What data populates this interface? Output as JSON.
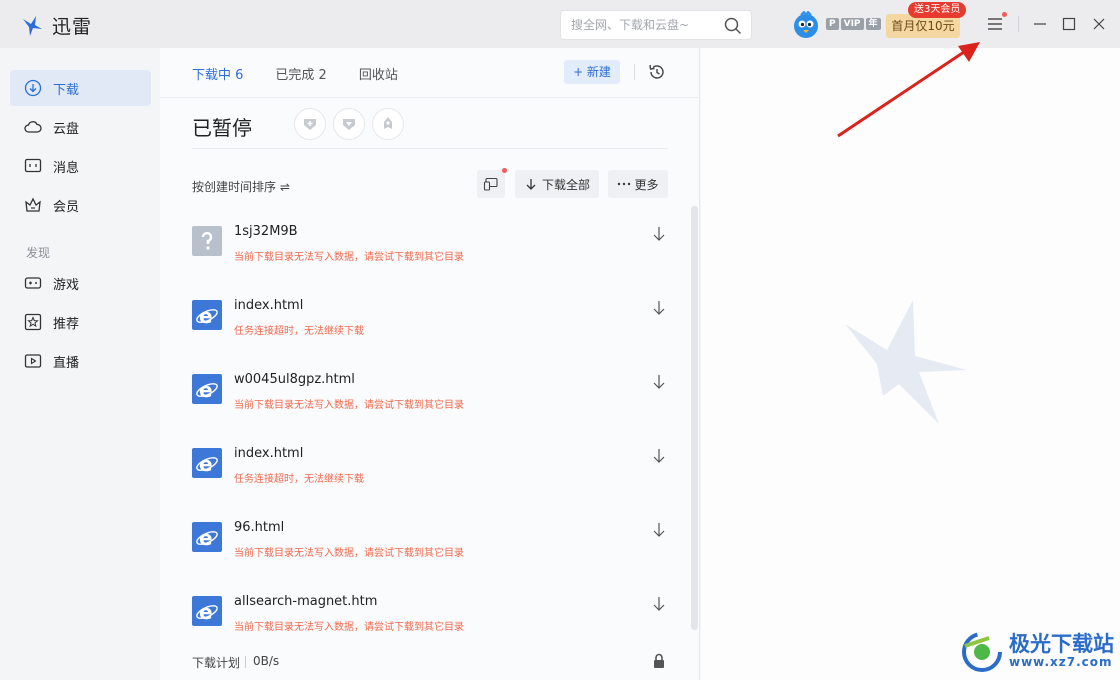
{
  "app": {
    "title": "迅雷"
  },
  "search": {
    "placeholder": "搜全网、下载和云盘~"
  },
  "account": {
    "badge_p": "P",
    "badge_vip": "VIP",
    "badge_year": "年"
  },
  "promo": {
    "label": "首月仅10元",
    "tag": "送3天会员"
  },
  "sidebar": {
    "items": [
      {
        "label": "下载",
        "icon": "download-icon",
        "active": true
      },
      {
        "label": "云盘",
        "icon": "cloud-icon"
      },
      {
        "label": "消息",
        "icon": "message-icon"
      },
      {
        "label": "会员",
        "icon": "crown-icon"
      }
    ],
    "section_label": "发现",
    "discover": [
      {
        "label": "游戏",
        "icon": "gamepad-icon"
      },
      {
        "label": "推荐",
        "icon": "star-icon"
      },
      {
        "label": "直播",
        "icon": "live-icon"
      }
    ]
  },
  "tabs": [
    {
      "label": "下载中 6",
      "active": true
    },
    {
      "label": "已完成 2"
    },
    {
      "label": "回收站"
    }
  ],
  "toolbar": {
    "new_label": "+ 新建"
  },
  "section": {
    "title": "已暂停"
  },
  "list_controls": {
    "sort_label": "按创建时间排序 ⇌",
    "download_all": "下载全部",
    "more": "更多"
  },
  "downloads": [
    {
      "name": "1sj32M9B",
      "error": "当前下载目录无法写入数据，请尝试下载到其它目录",
      "type": "unknown"
    },
    {
      "name": "index.html",
      "error": "任务连接超时，无法继续下载",
      "type": "html"
    },
    {
      "name": "w0045ul8gpz.html",
      "error": "当前下载目录无法写入数据，请尝试下载到其它目录",
      "type": "html"
    },
    {
      "name": "index.html",
      "error": "任务连接超时，无法继续下载",
      "type": "html"
    },
    {
      "name": "96.html",
      "error": "当前下载目录无法写入数据，请尝试下载到其它目录",
      "type": "html"
    },
    {
      "name": "allsearch-magnet.htm",
      "error": "当前下载目录无法写入数据，请尝试下载到其它目录",
      "type": "html"
    }
  ],
  "footer": {
    "plan_label": "下载计划",
    "speed": "0B/s"
  },
  "watermark": {
    "text": "极光下载站",
    "url": "www.xz7.com"
  },
  "colors": {
    "accent": "#2b6fd6",
    "error": "#ee6a4e",
    "annotation_arrow": "#d9231c"
  }
}
